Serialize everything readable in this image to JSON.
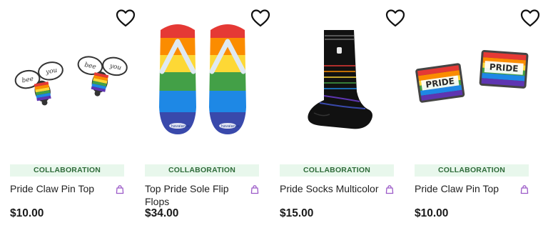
{
  "products": [
    {
      "badge": "COLLABORATION",
      "title": "Pride Claw Pin Top",
      "price": "$10.00",
      "image_icon": "bee-you-pins-icon"
    },
    {
      "badge": "COLLABORATION",
      "title": "Top Pride Sole Flip Flops",
      "price": "$34.00",
      "image_icon": "rainbow-flip-flops-icon"
    },
    {
      "badge": "COLLABORATION",
      "title": "Pride Socks Multicolor",
      "price": "$15.00",
      "image_icon": "rainbow-sock-icon"
    },
    {
      "badge": "COLLABORATION",
      "title": "Pride Claw Pin Top",
      "price": "$10.00",
      "image_icon": "pride-flag-pins-icon"
    }
  ],
  "pin_text": {
    "bee": "bee",
    "you": "you",
    "pride": "PRIDE",
    "brand": "havaianas"
  },
  "colors": {
    "badge_bg": "#e8f7ec",
    "badge_text": "#2f6b3a",
    "bag_icon": "#9b59c8",
    "rainbow": [
      "#e53935",
      "#fb8c00",
      "#fdd835",
      "#43a047",
      "#1e88e5",
      "#5e35b1"
    ]
  }
}
